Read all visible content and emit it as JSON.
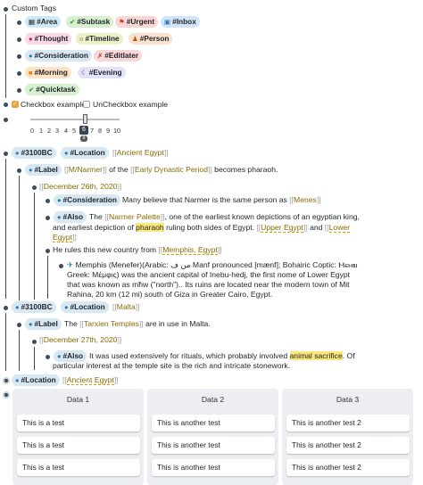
{
  "custom_tags": {
    "title": "Custom Tags",
    "row1": [
      {
        "icon": "🔢",
        "label": "#Area",
        "bg": "#cfe8f6"
      },
      {
        "icon": "✔",
        "label": "#Subtask",
        "bg": "#d7f0d0"
      },
      {
        "icon": "▶",
        "label": "#Urgent",
        "bg": "#fbd6d6"
      },
      {
        "icon": "📥",
        "label": "#Inbox",
        "bg": "#d2e4f7"
      }
    ],
    "row2": [
      {
        "icon": "💭",
        "label": "#Thought",
        "bg": "#fad8e8"
      },
      {
        "icon": "⏳",
        "label": "#Timeline",
        "bg": "#eef1c8"
      },
      {
        "icon": "👤",
        "label": "#Person",
        "bg": "#fbe2cf"
      }
    ],
    "row3": [
      {
        "icon": "💧",
        "label": "#Consideration",
        "bg": "#d8e8f2"
      },
      {
        "icon": "⚒",
        "label": "#Editlater",
        "bg": "#f8d7d7"
      }
    ],
    "row4": [
      {
        "icon": "🌅",
        "label": "#Morning",
        "bg": "#fde2c4"
      },
      {
        "icon": "🌙",
        "label": "#Evening",
        "bg": "#e4e2f7"
      }
    ],
    "row5": [
      {
        "icon": "✔",
        "label": "#Quicktask",
        "bg": "#d7f0d0"
      }
    ]
  },
  "checkbox": {
    "checked_label": "Checkbox example",
    "unchecked_label": "UnCheckbox example"
  },
  "slider": {
    "ticks": [
      "0",
      "1",
      "2",
      "3",
      "4",
      "5",
      "6",
      "7",
      "8",
      "9",
      "10"
    ],
    "selected": "6",
    "below_label": "8"
  },
  "block1": {
    "tag1": "#3100BC",
    "tag2": "#Location",
    "place": "Ancient Egypt",
    "label_tag": "#Label",
    "narmer": "M/Narmer",
    "of_the": "of the",
    "early_period": "Early Dynastic Period",
    "becomes": "becomes pharaoh.",
    "date": "December 26th, 2020",
    "consideration_tag": "#Consideration",
    "many_believe": "Many believe that Narmer is the same person as",
    "menes": "Menes",
    "also_tag": "#Also",
    "the": "The",
    "palette": "Narmer Palette",
    "palette_rest": ", one of the earliest known depictions of an egyptian king,",
    "line2a": "and earliest depiction of",
    "pharaoh": "pharaoh",
    "line2b": "ruling both sides of Egypt.",
    "upper": "Upper Egypt",
    "and": "and",
    "lower_a": "Lower",
    "lower_b": "Egypt",
    "rules": "He rules this new country from",
    "memphis": "Memphis, Egypt",
    "memphis_desc": [
      "Memphis (Menefer)(Arabic: من ف Manf pronounced [mænf]; Bohairic Coptic: Ⲙⲉⲙⲃⲓ",
      "Greek: Μέμφις) was the ancient capital of Inebu-hedj, the first nome of Lower Egypt",
      "that was known as mħw (\"north\").. Its ruins are located near the modern town of Mit",
      "Rahina, 20 km (12 mi) south of Giza in Greater Cairo, Egypt."
    ]
  },
  "block2": {
    "tag1": "#3100BC",
    "tag2": "#Location",
    "place": "Malta",
    "label_tag": "#Label",
    "the": "The",
    "temples": "Tarxien Temples",
    "rest": "are in use in Malta.",
    "date": "December 27th, 2020",
    "also_tag": "#Also",
    "line1a": "It was used extensively for rituals, which probably involved",
    "sacrifice": "animal sacrifice",
    "line1b": ". Of",
    "line2": "particular interest at the temple site is the rich and intricate stonework."
  },
  "block3": {
    "tag": "#Location",
    "place": "Ancient Egypt"
  },
  "kanban": {
    "columns": [
      {
        "title": "Data 1",
        "cards": [
          "This is a test",
          "This is a test",
          "This is a test"
        ]
      },
      {
        "title": "Data 2",
        "cards": [
          "This is another test",
          "This is another test",
          "This is another test"
        ]
      },
      {
        "title": "Data 3",
        "cards": [
          "This is another test 2",
          "This is another test 2",
          "This is another test 2"
        ]
      }
    ]
  },
  "colors": {
    "bullet": "#3d4b5c",
    "ref_text": "#8a6a00",
    "highlight": "#fbe87a",
    "tag_blue": "#d8e8f2",
    "checkbox_checked": "#e8a33a",
    "kanban_bg": "#eceef1"
  }
}
